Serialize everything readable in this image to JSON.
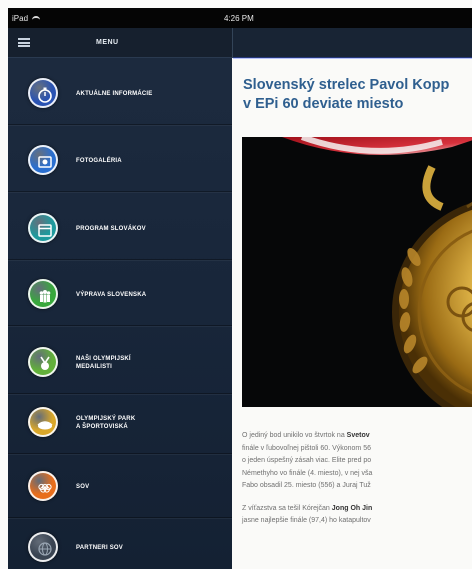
{
  "status_bar": {
    "device": "iPad",
    "time": "4:26 PM"
  },
  "menu": {
    "title": "MENU",
    "items": [
      {
        "label": "AKTUÁLNE INFORMÁCIE",
        "icon": "stopwatch-icon",
        "color": "#2a53b3"
      },
      {
        "label": "FOTOGALÉRIA",
        "icon": "photo-icon",
        "color": "#2a6fd0"
      },
      {
        "label": "PROGRAM SLOVÁKOV",
        "icon": "calendar-icon",
        "color": "#1e9a9d"
      },
      {
        "label": "VÝPRAVA SLOVENSKA",
        "icon": "team-icon",
        "color": "#38a83c"
      },
      {
        "label": "NAŠI OLYMPIJSKÍ\nMEDAILISTI",
        "icon": "medal-icon",
        "color": "#62b03a"
      },
      {
        "label": "OLYMPIJSKÝ PARK\nA ŠPORTOVISKÁ",
        "icon": "stadium-icon",
        "color": "#d9a72a"
      },
      {
        "label": "SOV",
        "icon": "rings-icon",
        "color": "#e86e1c"
      },
      {
        "label": "PARTNERI SOV",
        "icon": "globe-icon",
        "color": "#3a4452"
      }
    ]
  },
  "article": {
    "title": "Slovenský strelec Pavol Kopp\nv EPi 60 deviate miesto",
    "paragraphs": [
      {
        "lead": "O jediný bod unikilo vo štvrtok na ",
        "bold": "Svetov",
        "rest": "\nfinále v ľubovoľnej pištoli 60. Výkonom 56\no jeden úspešný zásah viac. Elite pred po\nNémethyho vo finále (4. miesto), v nej vša\nFabo obsadil 25. miesto (556) a Juraj Tuž"
      },
      {
        "lead": "Z víťazstva sa tešil Kórejčan ",
        "bold": "Jong Oh Jin",
        "rest": "\njasne najlepšie finále (97,4) ho katapultov"
      }
    ]
  }
}
